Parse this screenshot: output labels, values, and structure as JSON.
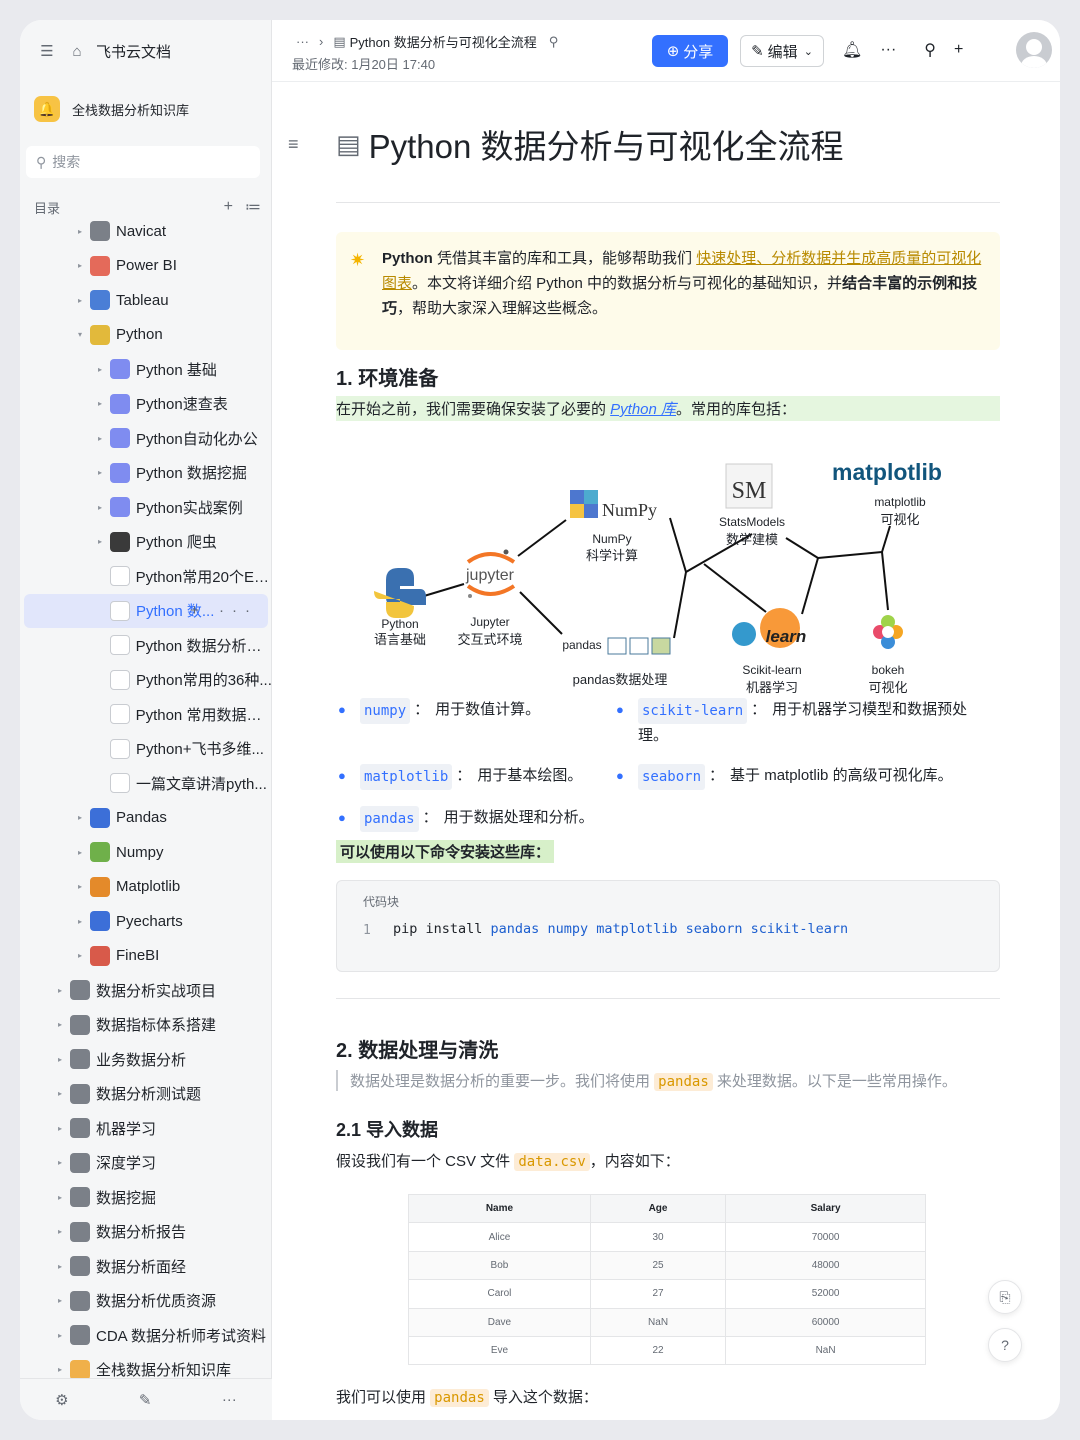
{
  "app": {
    "name": "飞书云文档"
  },
  "kb": {
    "name": "全栈数据分析知识库"
  },
  "search": {
    "placeholder": "搜索"
  },
  "toc": {
    "label": "目录"
  },
  "tree": [
    {
      "label": "Navicat",
      "level": 1,
      "arrow": "▸",
      "icon": "navicat-icon",
      "color": "#7b8088"
    },
    {
      "label": "Power BI",
      "level": 1,
      "arrow": "▸",
      "icon": "chart-icon",
      "color": "#e46a5a"
    },
    {
      "label": "Tableau",
      "level": 1,
      "arrow": "▸",
      "icon": "chart-icon",
      "color": "#4a7ed6"
    },
    {
      "label": "Python",
      "level": 1,
      "arrow": "▾",
      "icon": "python-icon",
      "color": "#e2b93b"
    },
    {
      "label": "Python 基础",
      "level": 2,
      "arrow": "▸",
      "icon": "doc-icon",
      "color": "#7f8cf0"
    },
    {
      "label": "Python速查表",
      "level": 2,
      "arrow": "▸",
      "icon": "doc-icon",
      "color": "#7f8cf0"
    },
    {
      "label": "Python自动化办公",
      "level": 2,
      "arrow": "▸",
      "icon": "doc-icon",
      "color": "#7f8cf0"
    },
    {
      "label": "Python 数据挖掘",
      "level": 2,
      "arrow": "▸",
      "icon": "doc-icon",
      "color": "#7f8cf0"
    },
    {
      "label": "Python实战案例",
      "level": 2,
      "arrow": "▸",
      "icon": "doc-icon",
      "color": "#7f8cf0"
    },
    {
      "label": "Python 爬虫",
      "level": 2,
      "arrow": "▸",
      "icon": "spider-icon",
      "color": "#3a3a3a"
    },
    {
      "label": "Python常用20个Ex...",
      "level": 2,
      "arrow": "",
      "icon": "file-icon",
      "color": "#c9ccd1"
    },
    {
      "label": "Python 数...",
      "level": 2,
      "arrow": "",
      "icon": "file-icon",
      "color": "#c9ccd1",
      "active": true
    },
    {
      "label": "Python 数据分析与...",
      "level": 2,
      "arrow": "",
      "icon": "file-icon",
      "color": "#c9ccd1"
    },
    {
      "label": "Python常用的36种...",
      "level": 2,
      "arrow": "",
      "icon": "file-icon",
      "color": "#c9ccd1"
    },
    {
      "label": "Python 常用数据结...",
      "level": 2,
      "arrow": "",
      "icon": "file-icon",
      "color": "#c9ccd1"
    },
    {
      "label": "Python+飞书多维...",
      "level": 2,
      "arrow": "",
      "icon": "file-icon",
      "color": "#c9ccd1"
    },
    {
      "label": "一篇文章讲清pyth...",
      "level": 2,
      "arrow": "",
      "icon": "file-icon",
      "color": "#c9ccd1"
    },
    {
      "label": "Pandas",
      "level": 1,
      "arrow": "▸",
      "icon": "book-icon",
      "color": "#3c6fd8"
    },
    {
      "label": "Numpy",
      "level": 1,
      "arrow": "▸",
      "icon": "book-icon",
      "color": "#6fb04a"
    },
    {
      "label": "Matplotlib",
      "level": 1,
      "arrow": "▸",
      "icon": "book-icon",
      "color": "#e48a2a"
    },
    {
      "label": "Pyecharts",
      "level": 1,
      "arrow": "▸",
      "icon": "bar-icon",
      "color": "#3c6fd8"
    },
    {
      "label": "FineBI",
      "level": 1,
      "arrow": "▸",
      "icon": "calendar-icon",
      "color": "#d85a4a"
    },
    {
      "label": "数据分析实战项目",
      "level": 0,
      "arrow": "▸",
      "icon": "folder-icon",
      "color": "#7b8088"
    },
    {
      "label": "数据指标体系搭建",
      "level": 0,
      "arrow": "▸",
      "icon": "folder-icon",
      "color": "#7b8088"
    },
    {
      "label": "业务数据分析",
      "level": 0,
      "arrow": "▸",
      "icon": "folder-icon",
      "color": "#7b8088"
    },
    {
      "label": "数据分析测试题",
      "level": 0,
      "arrow": "▸",
      "icon": "folder-icon",
      "color": "#7b8088"
    },
    {
      "label": "机器学习",
      "level": 0,
      "arrow": "▸",
      "icon": "folder-icon",
      "color": "#7b8088"
    },
    {
      "label": "深度学习",
      "level": 0,
      "arrow": "▸",
      "icon": "folder-icon",
      "color": "#7b8088"
    },
    {
      "label": "数据挖掘",
      "level": 0,
      "arrow": "▸",
      "icon": "folder-icon",
      "color": "#7b8088"
    },
    {
      "label": "数据分析报告",
      "level": 0,
      "arrow": "▸",
      "icon": "folder-icon",
      "color": "#7b8088"
    },
    {
      "label": "数据分析面经",
      "level": 0,
      "arrow": "▸",
      "icon": "folder-icon",
      "color": "#7b8088"
    },
    {
      "label": "数据分析优质资源",
      "level": 0,
      "arrow": "▸",
      "icon": "folder-icon",
      "color": "#7b8088"
    },
    {
      "label": "CDA 数据分析师考试资料",
      "level": 0,
      "arrow": "▸",
      "icon": "folder-icon",
      "color": "#7b8088"
    },
    {
      "label": "全栈数据分析知识库",
      "level": 0,
      "arrow": "▸",
      "icon": "kb-icon",
      "color": "#f0b04a"
    }
  ],
  "header": {
    "crumb_more": "···",
    "crumb_title": "Python 数据分析与可视化全流程",
    "modified": "最近修改: 1月20日 17:40",
    "share_label": "分享",
    "edit_label": "编辑"
  },
  "doc": {
    "title": "Python 数据分析与可视化全流程",
    "callout": {
      "bold1": "Python",
      "t1": " 凭借其丰富的库和工具，能够帮助我们 ",
      "link": "快速处理、分析数据并生成高质量的可视化图表",
      "t2": "。本文将详细介绍 Python 中的数据分析与可视化的基础知识，并",
      "bold2": "结合丰富的示例和技巧",
      "t3": "，帮助大家深入理解这些概念。"
    },
    "s1": {
      "title": "1. 环境准备",
      "intro_a": "在开始之前，我们需要确保安装了必要的 ",
      "intro_link": "Python 库",
      "intro_b": "。常用的库包括："
    },
    "diagram": {
      "python": {
        "name": "Python",
        "desc": "语言基础"
      },
      "jupyter": {
        "logo": "jupyter",
        "name": "Jupyter",
        "desc": "交互式环境"
      },
      "numpy": {
        "logo": "NumPy",
        "name": "NumPy",
        "desc": "科学计算"
      },
      "pandas": {
        "logo": "pandas",
        "desc": "pandas数据处理"
      },
      "statsmodels": {
        "logo": "SM",
        "name": "StatsModels",
        "desc": "数学建模"
      },
      "sklearn": {
        "logo": "learn",
        "name": "Scikit-learn",
        "desc": "机器学习"
      },
      "matplotlib": {
        "logo": "matplotlib",
        "name": "matplotlib",
        "desc": "可视化"
      },
      "bokeh": {
        "name": "bokeh",
        "desc": "可视化"
      }
    },
    "libs": [
      {
        "code": "numpy",
        "desc": "用于数值计算。"
      },
      {
        "code": "scikit-learn",
        "desc": "用于机器学习模型和数据预处",
        "desc2": "理。"
      },
      {
        "code": "matplotlib",
        "desc": "用于基本绘图。"
      },
      {
        "code": "seaborn",
        "desc": "基于 matplotlib 的高级可视化库。"
      },
      {
        "code": "pandas",
        "desc": "用于数据处理和分析。"
      }
    ],
    "install_note": "可以使用以下命令安装这些库：",
    "codeblock": {
      "caption": "代码块",
      "line": "1",
      "cmd": "pip install",
      "pkgs": "pandas numpy matplotlib seaborn scikit-learn"
    },
    "s2": {
      "title": "2. 数据处理与清洗",
      "quote_a": "数据处理是数据分析的重要一步。我们将使用 ",
      "quote_code": "pandas",
      "quote_b": " 来处理数据。以下是一些常用操作。"
    },
    "s21": {
      "title": "2.1 导入数据",
      "p_a": "假设我们有一个 CSV 文件 ",
      "p_code": "data.csv",
      "p_b": "，内容如下："
    },
    "table": {
      "headers": [
        "Name",
        "Age",
        "Salary"
      ],
      "rows": [
        [
          "Alice",
          "30",
          "70000"
        ],
        [
          "Bob",
          "25",
          "48000"
        ],
        [
          "Carol",
          "27",
          "52000"
        ],
        [
          "Dave",
          "NaN",
          "60000"
        ],
        [
          "Eve",
          "22",
          "NaN"
        ]
      ]
    },
    "last": {
      "a": "我们可以使用 ",
      "code": "pandas",
      "b": " 导入这个数据："
    }
  }
}
